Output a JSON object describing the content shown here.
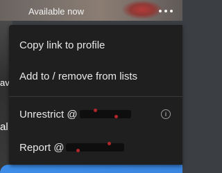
{
  "header": {
    "status_text": "Available now",
    "more_icon": "more-horizontal-icon"
  },
  "background": {
    "fragment_1": "av",
    "fragment_2": "al"
  },
  "menu": {
    "items": [
      {
        "label": "Copy link to profile"
      },
      {
        "label": "Add to / remove from lists"
      },
      {
        "label": "Unrestrict @",
        "trailing_icon": "info-icon"
      },
      {
        "label": "Report @"
      }
    ]
  },
  "colors": {
    "menu_bg": "#1f1f1f",
    "menu_text": "#e9e9e9",
    "accent_blue": "#3d8de8"
  }
}
